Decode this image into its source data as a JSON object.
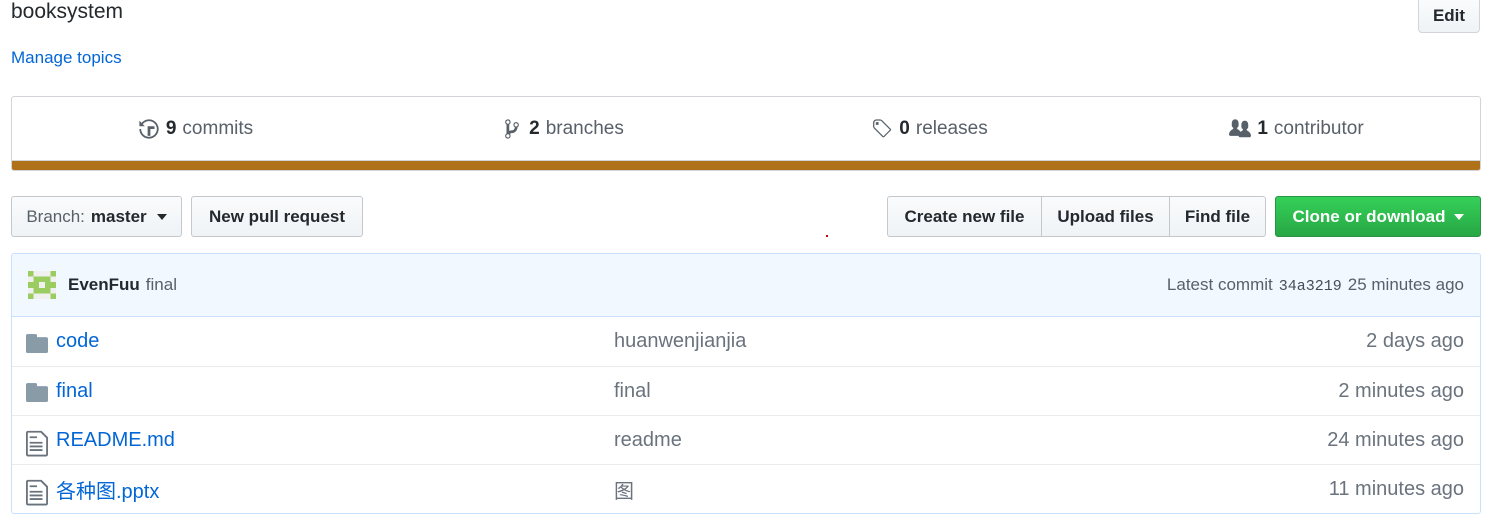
{
  "repo": {
    "description": "booksystem",
    "manage_topics": "Manage topics",
    "edit_label": "Edit"
  },
  "summary": {
    "commits": {
      "num": "9",
      "label": "commits",
      "icon": "history-icon"
    },
    "branches": {
      "num": "2",
      "label": "branches",
      "icon": "branch-icon"
    },
    "releases": {
      "num": "0",
      "label": "releases",
      "icon": "tag-icon"
    },
    "contributors": {
      "num": "1",
      "label": "contributor",
      "icon": "people-icon"
    },
    "language_bar_color": "#b07219"
  },
  "toolbar": {
    "branch_label": "Branch:",
    "branch_value": "master",
    "new_pull_request": "New pull request",
    "create_new_file": "Create new file",
    "upload_files": "Upload files",
    "find_file": "Find file",
    "clone_or_download": "Clone or download"
  },
  "latest_commit": {
    "author": "EvenFuu",
    "message": "final",
    "prefix": "Latest commit",
    "sha": "34a3219",
    "time": "25 minutes ago"
  },
  "files": [
    {
      "name": "code",
      "type": "folder",
      "message": "huanwenjianjia",
      "age": "2 days ago"
    },
    {
      "name": "final",
      "type": "folder",
      "message": "final",
      "age": "2 minutes ago"
    },
    {
      "name": "README.md",
      "type": "file",
      "message": "readme",
      "age": "24 minutes ago"
    },
    {
      "name": "各种图.pptx",
      "type": "file",
      "message": "图",
      "age": "11 minutes ago"
    }
  ],
  "colors": {
    "link": "#0366d6",
    "clone_green": "#28a745",
    "commit_bg": "#f1f8ff"
  }
}
